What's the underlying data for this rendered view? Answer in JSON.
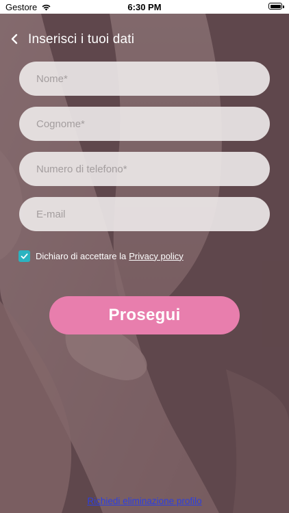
{
  "status_bar": {
    "carrier": "Gestore",
    "time": "6:30 PM"
  },
  "header": {
    "title": "Inserisci i tuoi dati"
  },
  "form": {
    "fields": [
      {
        "placeholder": "Nome*",
        "value": ""
      },
      {
        "placeholder": "Cognome*",
        "value": ""
      },
      {
        "placeholder": "Numero di telefono*",
        "value": ""
      },
      {
        "placeholder": "E-mail",
        "value": ""
      }
    ],
    "consent": {
      "checked": true,
      "text": "Dichiaro di accettare la",
      "link_label": "Privacy policy"
    },
    "submit_label": "Prosegui"
  },
  "footer": {
    "delete_profile_label": "Richiedi eliminazione profilo"
  },
  "colors": {
    "accent_pink": "#e87ead",
    "checkbox_teal": "#2bb3c0",
    "link_blue": "#2d3fe0"
  },
  "icons": {
    "back": "chevron-left-icon",
    "wifi": "wifi-icon",
    "battery": "battery-icon",
    "check": "check-icon"
  }
}
